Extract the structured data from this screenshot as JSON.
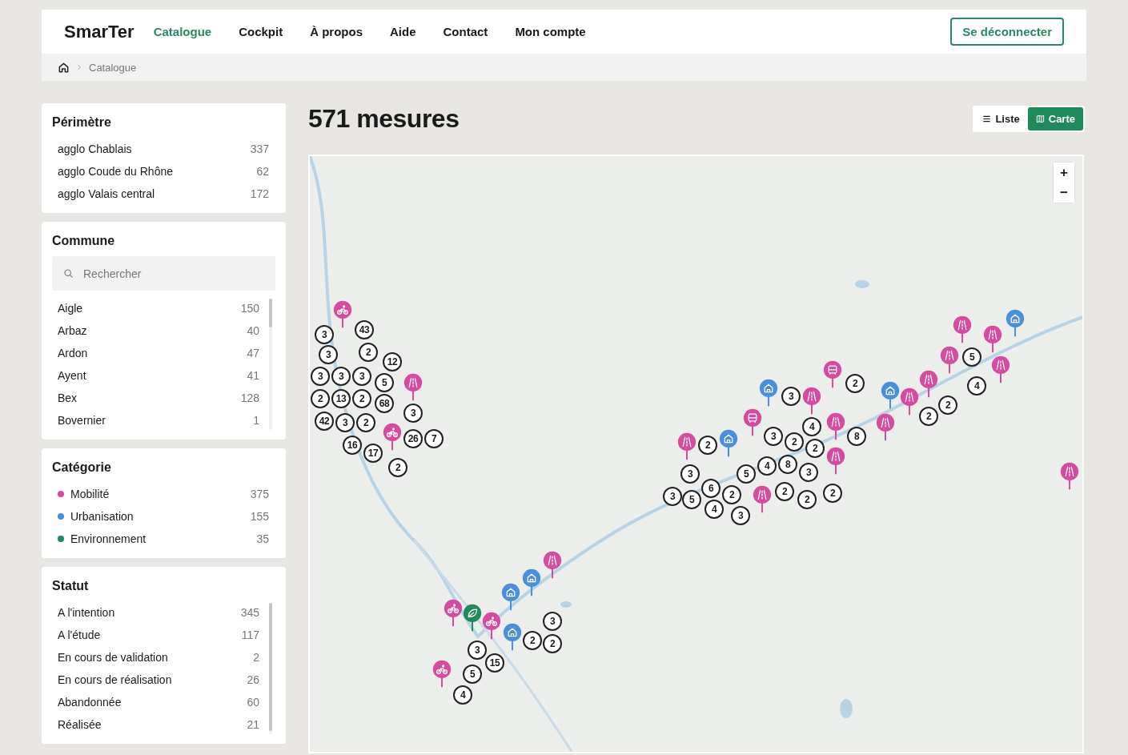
{
  "brand": "SmarTer",
  "nav": [
    {
      "label": "Catalogue",
      "selected": true
    },
    {
      "label": "Cockpit",
      "selected": false
    },
    {
      "label": "À propos",
      "selected": false
    },
    {
      "label": "Aide",
      "selected": false
    },
    {
      "label": "Contact",
      "selected": false
    },
    {
      "label": "Mon compte",
      "selected": false
    }
  ],
  "logout_button": "Se déconnecter",
  "breadcrumb": [
    "Catalogue"
  ],
  "filters": {
    "perimetre": {
      "title": "Périmètre",
      "items": [
        {
          "label": "agglo Chablais",
          "count": "337"
        },
        {
          "label": "agglo Coude du Rhône",
          "count": "62"
        },
        {
          "label": "agglo Valais central",
          "count": "172"
        }
      ]
    },
    "commune": {
      "title": "Commune",
      "search": {
        "placeholder": "Rechercher"
      },
      "items": [
        {
          "label": "Aigle",
          "count": "150"
        },
        {
          "label": "Arbaz",
          "count": "40"
        },
        {
          "label": "Ardon",
          "count": "47"
        },
        {
          "label": "Ayent",
          "count": "41"
        },
        {
          "label": "Bex",
          "count": "128"
        },
        {
          "label": "Bovernier",
          "count": "1"
        }
      ]
    },
    "categorie": {
      "title": "Catégorie",
      "items": [
        {
          "label": "Mobilité",
          "count": "375",
          "color": "#d64a9f"
        },
        {
          "label": "Urbanisation",
          "count": "155",
          "color": "#4a8fdb"
        },
        {
          "label": "Environnement",
          "count": "35",
          "color": "#1f8a5b"
        }
      ]
    },
    "statut": {
      "title": "Statut",
      "items": [
        {
          "label": "A l'intention",
          "count": "345"
        },
        {
          "label": "A l'étude",
          "count": "117"
        },
        {
          "label": "En cours de validation",
          "count": "2"
        },
        {
          "label": "En cours de réalisation",
          "count": "26"
        },
        {
          "label": "Abandonnée",
          "count": "60"
        },
        {
          "label": "Réalisée",
          "count": "21"
        }
      ]
    }
  },
  "results_title": "571 mesures",
  "view_toggle": [
    {
      "label": "Liste",
      "selected": false
    },
    {
      "label": "Carte",
      "selected": true
    }
  ],
  "map": {
    "zoom_in": "+",
    "zoom_out": "−",
    "markers": [
      {
        "kind": "cycling",
        "color": "#d64a9f"
      },
      {
        "kind": "road",
        "color": "#d64a9f"
      },
      {
        "kind": "house",
        "color": "#4a8fdb"
      },
      {
        "kind": "cluster",
        "label": "3"
      },
      {
        "kind": "cluster",
        "label": "43"
      },
      {
        "kind": "road",
        "color": "#d64a9f"
      },
      {
        "kind": "cluster",
        "label": "3"
      },
      {
        "kind": "cluster",
        "label": "2"
      },
      {
        "kind": "road",
        "color": "#d64a9f"
      },
      {
        "kind": "cluster",
        "label": "12"
      },
      {
        "kind": "cluster",
        "label": "5"
      },
      {
        "kind": "road",
        "color": "#d64a9f"
      },
      {
        "kind": "bus",
        "color": "#d64a9f"
      },
      {
        "kind": "cluster",
        "label": "3"
      },
      {
        "kind": "cluster",
        "label": "3"
      },
      {
        "kind": "cluster",
        "label": "3"
      },
      {
        "kind": "cluster",
        "label": "5"
      },
      {
        "kind": "road",
        "color": "#d64a9f"
      },
      {
        "kind": "cluster",
        "label": "2"
      },
      {
        "kind": "road",
        "color": "#d64a9f"
      },
      {
        "kind": "house",
        "color": "#4a8fdb"
      },
      {
        "kind": "house",
        "color": "#4a8fdb"
      },
      {
        "kind": "cluster",
        "label": "4"
      },
      {
        "kind": "cluster",
        "label": "2"
      },
      {
        "kind": "cluster",
        "label": "13"
      },
      {
        "kind": "cluster",
        "label": "2"
      },
      {
        "kind": "cluster",
        "label": "3"
      },
      {
        "kind": "road",
        "color": "#d64a9f"
      },
      {
        "kind": "road",
        "color": "#d64a9f"
      },
      {
        "kind": "cluster",
        "label": "68"
      },
      {
        "kind": "cluster",
        "label": "2"
      },
      {
        "kind": "cluster",
        "label": "3"
      },
      {
        "kind": "bus",
        "color": "#d64a9f"
      },
      {
        "kind": "cluster",
        "label": "42"
      },
      {
        "kind": "cluster",
        "label": "3"
      },
      {
        "kind": "cluster",
        "label": "2"
      },
      {
        "kind": "road",
        "color": "#d64a9f"
      },
      {
        "kind": "road",
        "color": "#d64a9f"
      },
      {
        "kind": "cluster",
        "label": "2"
      },
      {
        "kind": "cluster",
        "label": "4"
      },
      {
        "kind": "cycling",
        "color": "#d64a9f"
      },
      {
        "kind": "cluster",
        "label": "26"
      },
      {
        "kind": "cluster",
        "label": "7"
      },
      {
        "kind": "house",
        "color": "#4a8fdb"
      },
      {
        "kind": "cluster",
        "label": "3"
      },
      {
        "kind": "cluster",
        "label": "8"
      },
      {
        "kind": "cluster",
        "label": "16"
      },
      {
        "kind": "road",
        "color": "#d64a9f"
      },
      {
        "kind": "cluster",
        "label": "2"
      },
      {
        "kind": "cluster",
        "label": "2"
      },
      {
        "kind": "cluster",
        "label": "17"
      },
      {
        "kind": "cluster",
        "label": "2"
      },
      {
        "kind": "road",
        "color": "#d64a9f"
      },
      {
        "kind": "cluster",
        "label": "2"
      },
      {
        "kind": "cluster",
        "label": "3"
      },
      {
        "kind": "cluster",
        "label": "5"
      },
      {
        "kind": "cluster",
        "label": "4"
      },
      {
        "kind": "cluster",
        "label": "8"
      },
      {
        "kind": "cluster",
        "label": "3"
      },
      {
        "kind": "road",
        "color": "#d64a9f"
      },
      {
        "kind": "cluster",
        "label": "3"
      },
      {
        "kind": "cluster",
        "label": "5"
      },
      {
        "kind": "cluster",
        "label": "6"
      },
      {
        "kind": "cluster",
        "label": "2"
      },
      {
        "kind": "road",
        "color": "#d64a9f"
      },
      {
        "kind": "cluster",
        "label": "2"
      },
      {
        "kind": "cluster",
        "label": "2"
      },
      {
        "kind": "cluster",
        "label": "2"
      },
      {
        "kind": "cluster",
        "label": "4"
      },
      {
        "kind": "cluster",
        "label": "3"
      },
      {
        "kind": "road",
        "color": "#d64a9f"
      },
      {
        "kind": "house",
        "color": "#4a8fdb"
      },
      {
        "kind": "house",
        "color": "#4a8fdb"
      },
      {
        "kind": "cycling",
        "color": "#d64a9f"
      },
      {
        "kind": "leaf",
        "color": "#1f8a5b"
      },
      {
        "kind": "cycling",
        "color": "#d64a9f"
      },
      {
        "kind": "cluster",
        "label": "3"
      },
      {
        "kind": "house",
        "color": "#4a8fdb"
      },
      {
        "kind": "cluster",
        "label": "2"
      },
      {
        "kind": "cluster",
        "label": "2"
      },
      {
        "kind": "cluster",
        "label": "3"
      },
      {
        "kind": "cluster",
        "label": "15"
      },
      {
        "kind": "cycling",
        "color": "#d64a9f"
      },
      {
        "kind": "cluster",
        "label": "5"
      },
      {
        "kind": "cluster",
        "label": "4"
      }
    ]
  }
}
